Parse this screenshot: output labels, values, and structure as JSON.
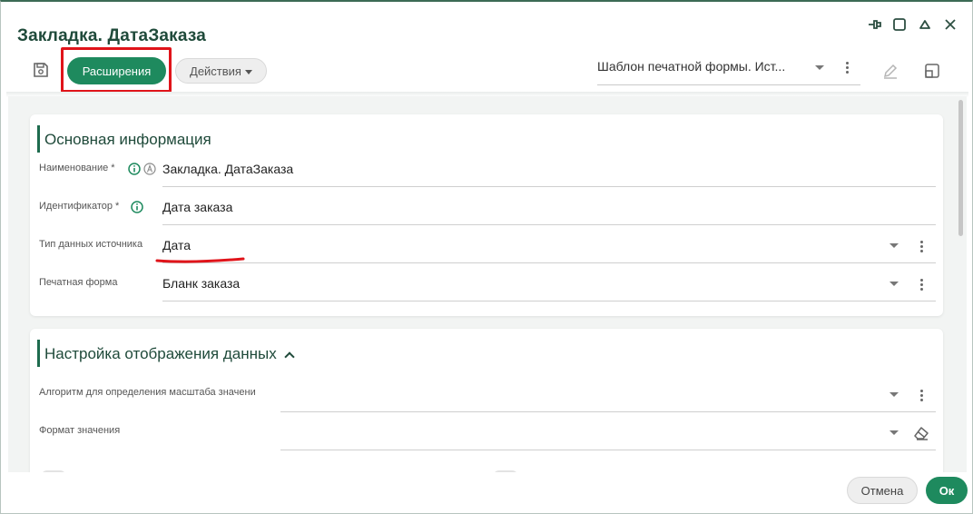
{
  "window": {
    "title": "Закладка. ДатаЗаказа",
    "controls": [
      "pin-icon",
      "maximize-icon",
      "collapse-icon",
      "close-icon"
    ]
  },
  "toolbar": {
    "save_icon": "save-icon",
    "extensions_label": "Расширения",
    "actions_label": "Действия",
    "template_value": "Шаблон печатной формы. Ист...",
    "edit_icon": "edit-icon",
    "open_icon": "open-in-window-icon"
  },
  "sections": {
    "main": {
      "title": "Основная информация",
      "fields": [
        {
          "label": "Наименование",
          "required": "*",
          "value": "Закладка. ДатаЗаказа"
        },
        {
          "label": "Идентификатор",
          "required": "*",
          "value": "Дата заказа"
        },
        {
          "label": "Тип данных источника",
          "value": "Дата"
        },
        {
          "label": "Печатная форма",
          "value": "Бланк заказа"
        }
      ]
    },
    "display": {
      "title": "Настройка отображения данных",
      "fields": [
        {
          "label": "Алгоритм для определения масштаба значени",
          "value": ""
        },
        {
          "label": "Формат значения",
          "value": ""
        }
      ]
    }
  },
  "footer": {
    "cancel_label": "Отмена",
    "ok_label": "Ок"
  },
  "colors": {
    "accent": "#1e8a5e",
    "title": "#1f4a3a",
    "highlight": "#e0141a"
  }
}
